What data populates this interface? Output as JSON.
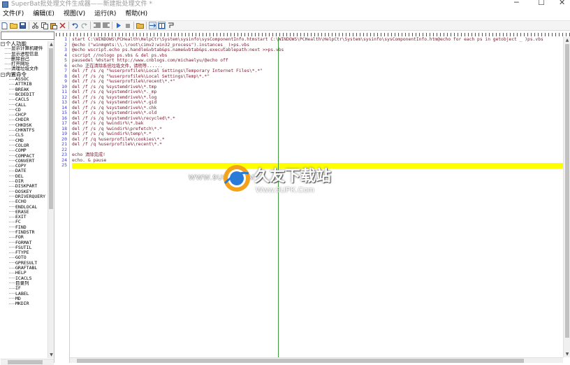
{
  "window": {
    "title": "SuperBat批处理文件生成器——新建批处理文件 *",
    "controls": {
      "minimize": "─",
      "maximize": "☐",
      "close": "✕"
    }
  },
  "menubar": {
    "items": [
      "文件(F)",
      "编辑(E)",
      "视图(V)",
      "运行(R)",
      "帮助(H)"
    ]
  },
  "toolbar": {
    "icons": [
      "new-file-icon",
      "open-file-icon",
      "save-icon",
      "cut-icon",
      "copy-icon",
      "paste-icon",
      "delete-icon",
      "undo-icon",
      "redo-icon",
      "indent-icon",
      "outdent-icon",
      "run-icon",
      "stop-icon",
      "folder-icon",
      "wrap-icon",
      "columns-icon",
      "split-icon"
    ]
  },
  "left_panel": {
    "search_value": "",
    "tree": [
      {
        "label": "个人功能",
        "level": 0,
        "expander": "−"
      },
      {
        "label": "显示计算机硬件",
        "level": 1
      },
      {
        "label": "显示进程信息",
        "level": 1
      },
      {
        "label": "删除自己",
        "level": 1
      },
      {
        "label": "打开网址",
        "level": 1
      },
      {
        "label": "清理垃圾文件",
        "level": 1
      },
      {
        "label": "内置命令",
        "level": 0,
        "expander": "−"
      },
      {
        "label": "ASSOC",
        "level": 2
      },
      {
        "label": "ATTRIB",
        "level": 2
      },
      {
        "label": "BREAK",
        "level": 2
      },
      {
        "label": "BCDEDIT",
        "level": 2
      },
      {
        "label": "CACLS",
        "level": 2
      },
      {
        "label": "CALL",
        "level": 2
      },
      {
        "label": "CD",
        "level": 2
      },
      {
        "label": "CHCP",
        "level": 2
      },
      {
        "label": "CHDIR",
        "level": 2
      },
      {
        "label": "CHKDSK",
        "level": 2
      },
      {
        "label": "CHKNTFS",
        "level": 2
      },
      {
        "label": "CLS",
        "level": 2
      },
      {
        "label": "CMD",
        "level": 2
      },
      {
        "label": "COLOR",
        "level": 2
      },
      {
        "label": "COMP",
        "level": 2
      },
      {
        "label": "COMPACT",
        "level": 2
      },
      {
        "label": "CONVERT",
        "level": 2
      },
      {
        "label": "COPY",
        "level": 2
      },
      {
        "label": "DATE",
        "level": 2
      },
      {
        "label": "DEL",
        "level": 2
      },
      {
        "label": "DIR",
        "level": 2
      },
      {
        "label": "DISKPART",
        "level": 2
      },
      {
        "label": "DOSKEY",
        "level": 2
      },
      {
        "label": "DRIVERQUERY",
        "level": 2
      },
      {
        "label": "ECHO",
        "level": 2
      },
      {
        "label": "ENDLOCAL",
        "level": 2
      },
      {
        "label": "ERASE",
        "level": 2
      },
      {
        "label": "EXIT",
        "level": 2
      },
      {
        "label": "FC",
        "level": 2
      },
      {
        "label": "FIND",
        "level": 2
      },
      {
        "label": "FINDSTR",
        "level": 2
      },
      {
        "label": "FOR",
        "level": 2
      },
      {
        "label": "FORMAT",
        "level": 2
      },
      {
        "label": "FSUTIL",
        "level": 2
      },
      {
        "label": "FTYPE",
        "level": 2
      },
      {
        "label": "GOTO",
        "level": 2
      },
      {
        "label": "GPRESULT",
        "level": 2
      },
      {
        "label": "GRAFTABL",
        "level": 2
      },
      {
        "label": "HELP",
        "level": 2
      },
      {
        "label": "ICACLS",
        "level": 2
      },
      {
        "label": "目录列",
        "level": 2
      },
      {
        "label": "IF",
        "level": 2
      },
      {
        "label": "LABEL",
        "level": 2
      },
      {
        "label": "MD",
        "level": 2
      },
      {
        "label": "MKDIR",
        "level": 2
      }
    ]
  },
  "editor": {
    "line_numbers": [
      "1",
      "2",
      "3",
      "4",
      "5",
      "6",
      "7",
      "8",
      "9",
      "10",
      "11",
      "12",
      "13",
      "14",
      "15",
      "16",
      "17",
      "18",
      "19",
      "20",
      "21",
      "22",
      "23",
      "24",
      "25"
    ],
    "lines": [
      "start C:\\WINDOWS\\PCHealth\\HelpCtr\\System\\sysinfo\\sysComponentInfo.htmstart C:\\WINDOWS\\PCHealth\\HelpCtr\\System\\sysinfo\\sysComponentInfo.htm@echo for each ps in getobject _ )ps.vbs",
      "@echo (\"winmgmts:\\\\.\\root\\cimv2:win32_process\").instances_ )>ps.vbs",
      "@echo wscript.echo ps.handle&vbtab&ps.name&vbtab&ps.executablepath:next >>ps.vbs",
      "cscript //nologo ps.vbs & del ps.vbs",
      "pausedel %0start http://www.cnblogs.com/michaelyu/@echo off",
      "echo 正在清除系统垃圾文件，请稍等......",
      "del /f /s /q \"%userprofile%\\Local Settings\\Temporary Internet Files\\*.*\"",
      "del /f /s /q \"%userprofile%\\Local Settings\\Temp\\*.*\"",
      "del /f /s /q \"%userprofile%\\recent\\*.*\"",
      "del /f /s /q %systemdrive%\\*.tmp",
      "del /f /s /q %systemdrive%\\*._mp",
      "del /f /s /q %systemdrive%\\*.log",
      "del /f /s /q %systemdrive%\\*.gid",
      "del /f /s /q %systemdrive%\\*.chk",
      "del /f /s /q %systemdrive%\\*.old",
      "del /f /s /q %systemdrive%\\recycled\\*.*",
      "del /f /s /q %windir%\\*.bak",
      "del /f /s /q %windir%\\prefetch\\*.*",
      "del /f /s /q %windir%\\temp\\*.*",
      "del /f /q %userprofile%\\cookies\\*.*",
      "del /f /q %userprofile%\\recent\\*.*",
      "",
      "echo 清除完成!",
      "echo. & pause",
      ""
    ],
    "current_line": 25
  },
  "watermark": {
    "site_left": "WWW.9UPK.COM",
    "brand": "久友下载站",
    "site_right": "Www.9UPK.Com"
  }
}
